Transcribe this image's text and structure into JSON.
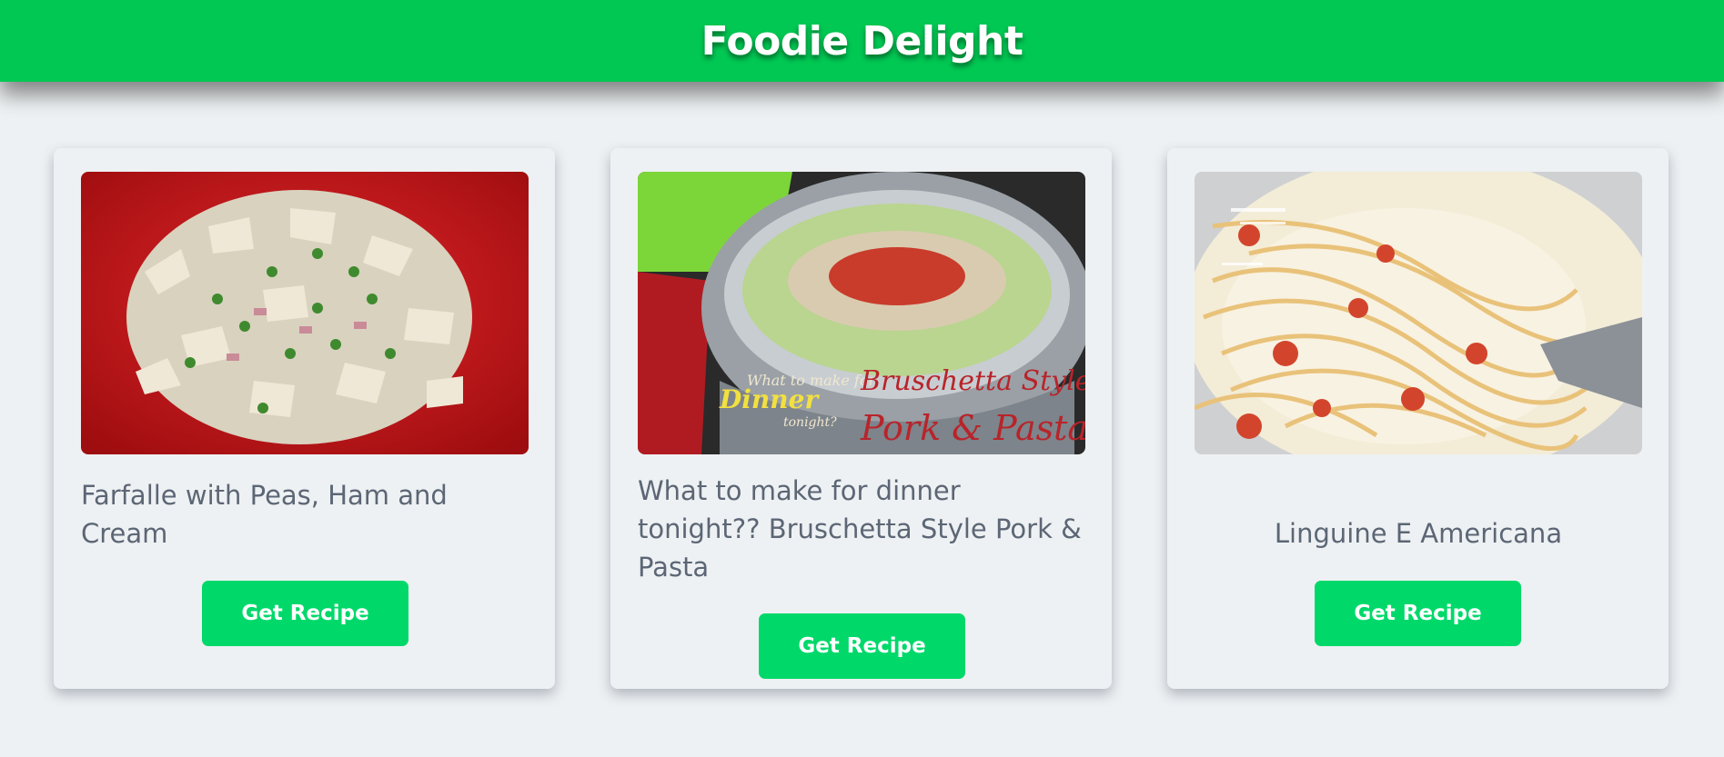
{
  "header": {
    "title": "Foodie Delight"
  },
  "recipes": [
    {
      "title": "Farfalle with Peas, Ham and Cream",
      "button_label": "Get Recipe",
      "image_icon": "farfalle-pasta-photo"
    },
    {
      "title": "What to make for dinner tonight?? Bruschetta Style Pork & Pasta",
      "button_label": "Get Recipe",
      "image_icon": "bruschetta-pork-pasta-photo",
      "image_overlay": {
        "line1": "What to make for",
        "line2": "Dinner",
        "line3": "tonight?",
        "caption1": "Bruschetta Style",
        "caption2": "Pork & Pasta"
      }
    },
    {
      "title": "Linguine E Americana",
      "button_label": "Get Recipe",
      "image_icon": "linguine-photo"
    }
  ],
  "colors": {
    "header": "#00c853",
    "button": "#00d96a",
    "background": "#eef1f3",
    "text": "#5c6675"
  }
}
